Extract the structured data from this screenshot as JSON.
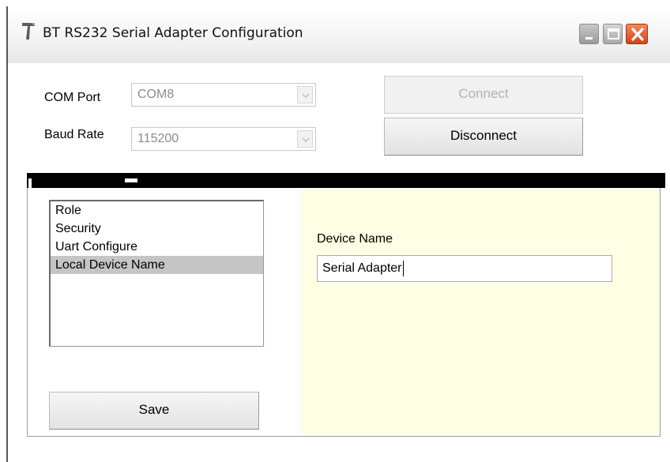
{
  "window": {
    "title": "BT RS232 Serial Adapter Configuration"
  },
  "titlebar": {
    "icons": [
      "app-icon",
      "minimize-icon",
      "maximize-icon",
      "close-icon"
    ]
  },
  "connection": {
    "com_port_label": "COM Port",
    "com_port_value": "COM8",
    "baud_rate_label": "Baud Rate",
    "baud_rate_value": "115200",
    "connect_label": "Connect",
    "disconnect_label": "Disconnect"
  },
  "settings_list": {
    "items": [
      "Role",
      "Security",
      "Uart Configure",
      "Local Device Name"
    ],
    "selected": "Local Device Name"
  },
  "save_label": "Save",
  "device_panel": {
    "label": "Device Name",
    "value": "Serial Adapter"
  },
  "colors": {
    "panel_background": "#fefee4",
    "selection": "#c5c5c5",
    "close_button": "#d2421a"
  }
}
